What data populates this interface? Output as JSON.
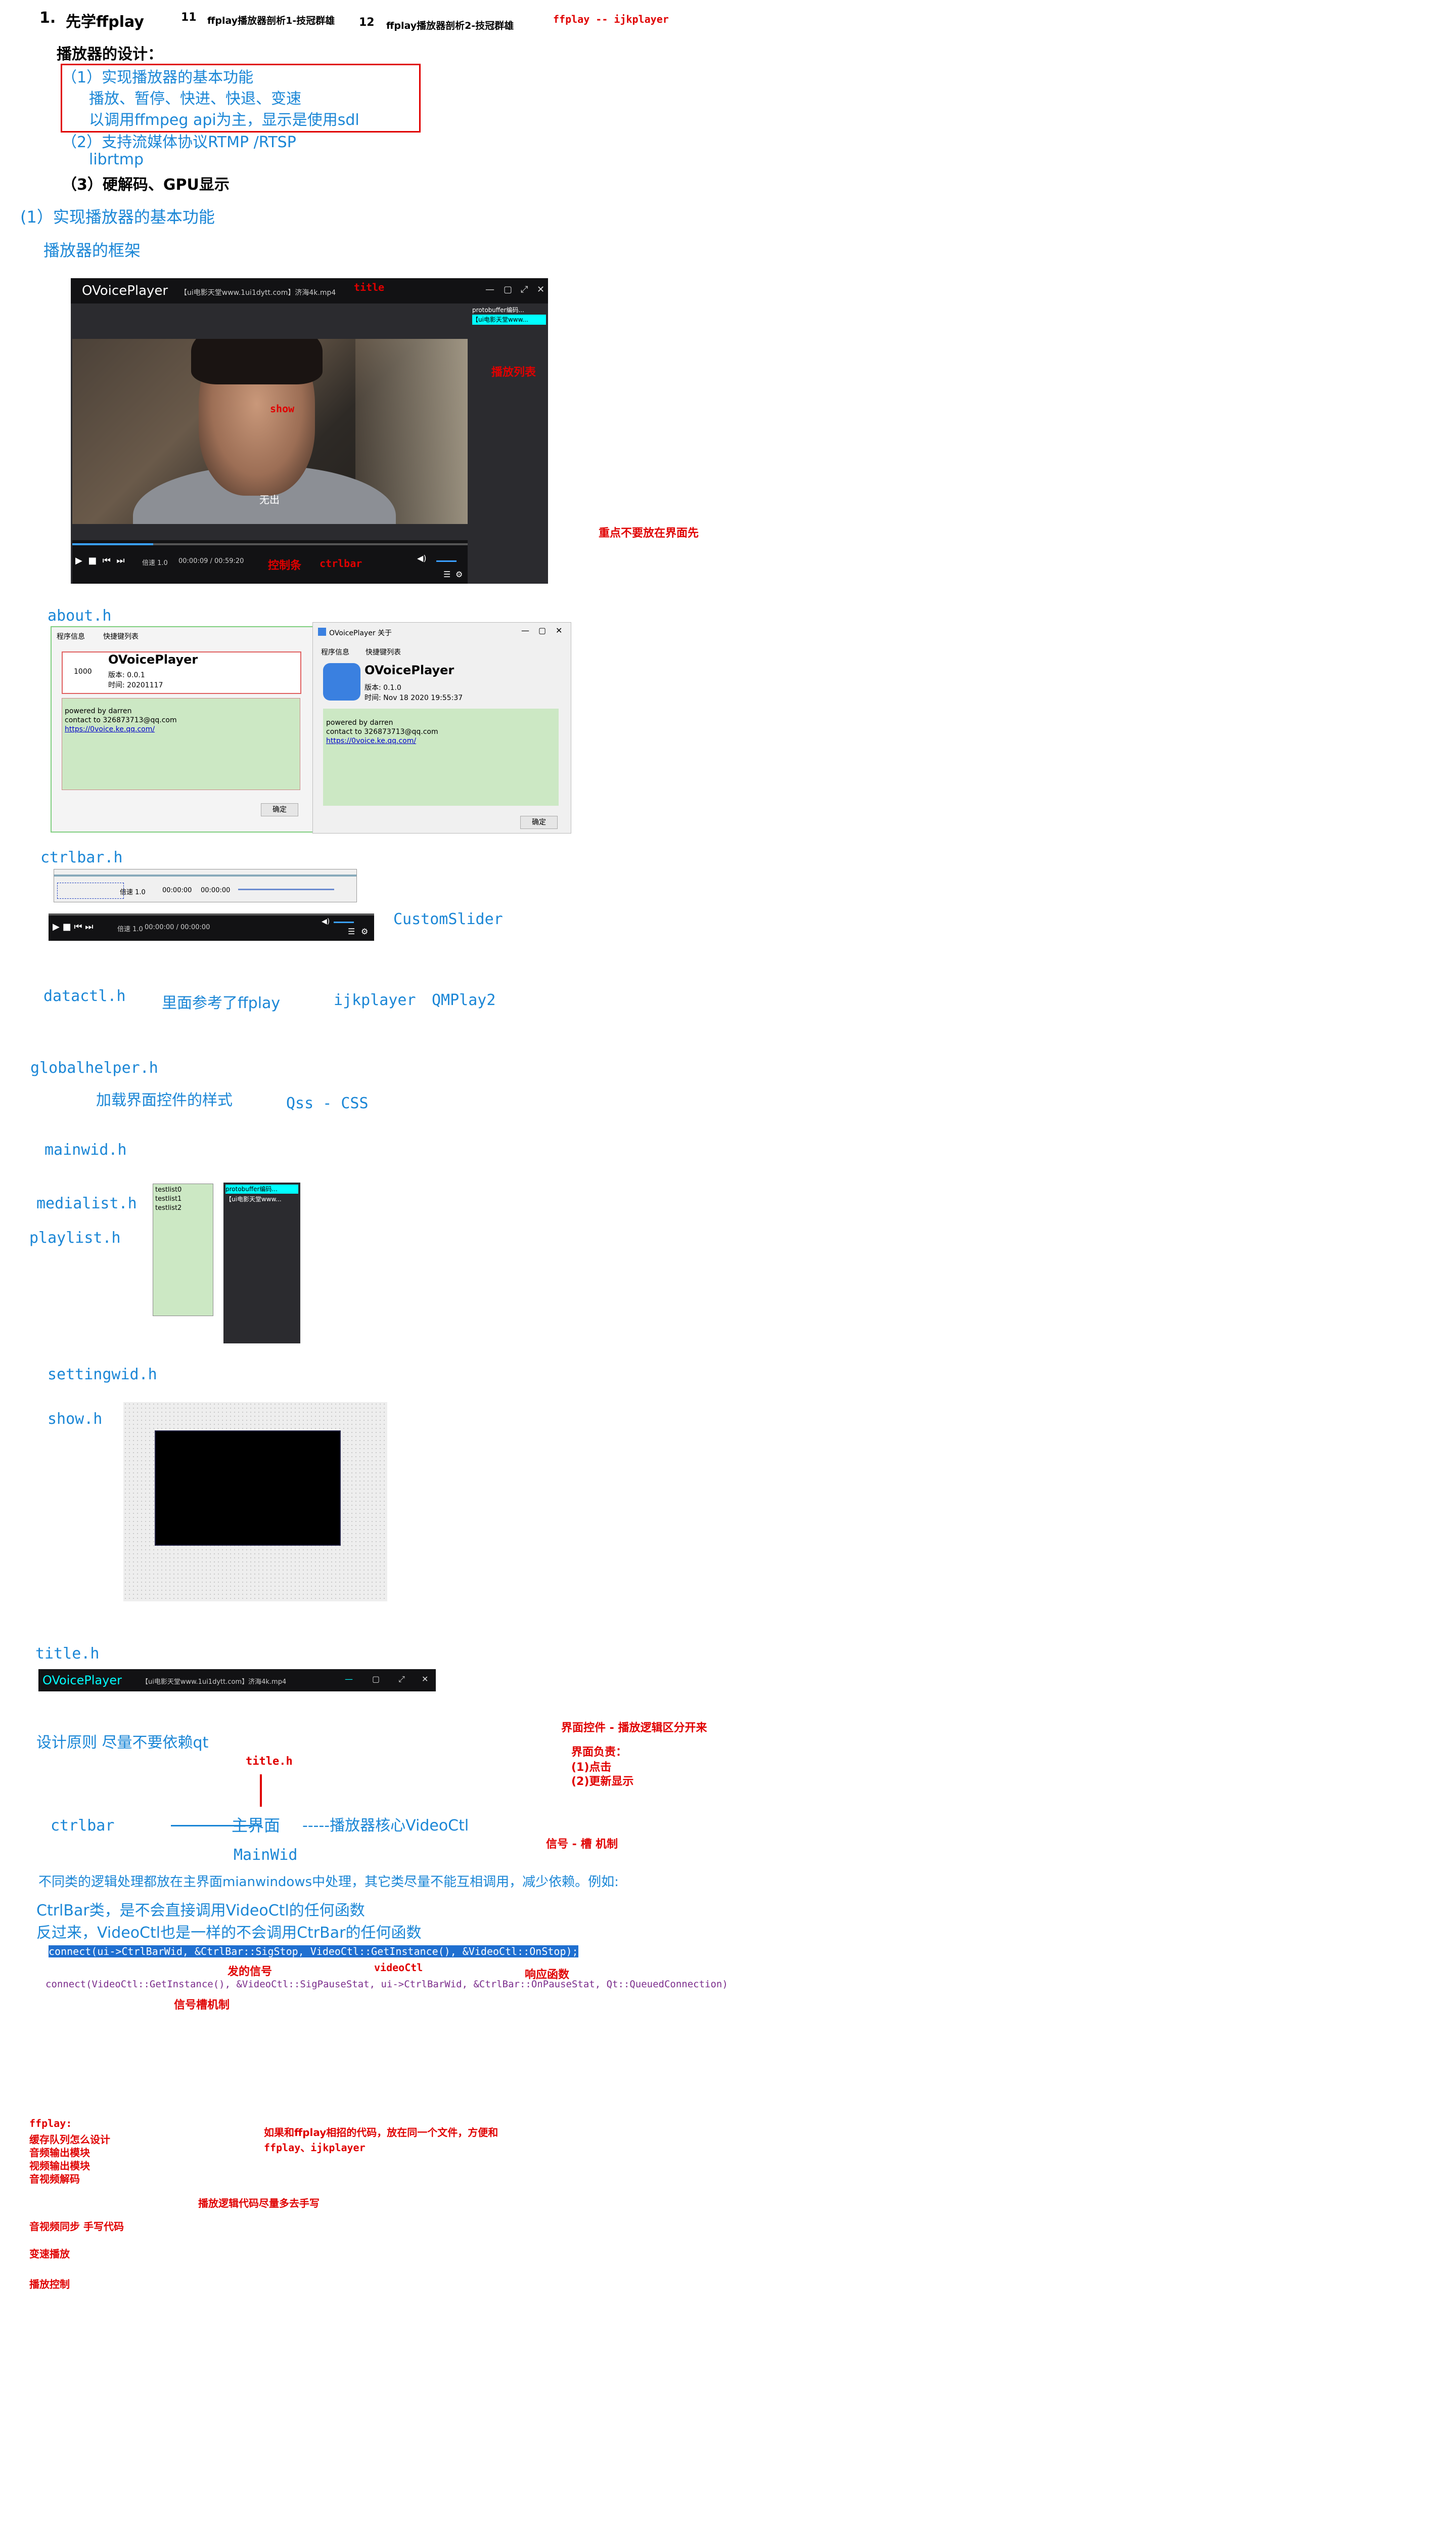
{
  "header": {
    "item1_prefix": "1.",
    "item1": "先学ffplay",
    "item2_num": "11",
    "item2": "ffplay播放器剖析1-技冠群雄",
    "item3_num": "12",
    "item3": "ffplay播放器剖析2-技冠群雄",
    "item4": "ffplay -- ijkplayer"
  },
  "design": {
    "title": "播放器的设计：",
    "p1": "（1）实现播放器的基本功能",
    "p1a": "播放、暂停、快进、快退、变速",
    "p1b": "以调用ffmpeg api为主，显示是使用sdl",
    "p2": "（2）支持流媒体协议RTMP /RTSP",
    "p2a": "librtmp",
    "p3": "（3）硬解码、GPU显示"
  },
  "section1": {
    "title": "(1）实现播放器的基本功能",
    "framework": "播放器的框架"
  },
  "player": {
    "logo": "OVoicePlayer",
    "filename": "【ui电影天堂www.1ui1dytt.com】济海4k.mp4",
    "title_label": "title",
    "show_label": "show",
    "playlist_label": "播放列表",
    "playlist_item1": "protobuffer编码...",
    "playlist_item2": "【ui电影天堂www...",
    "subtitle": "无出",
    "speed": "倍速 1.0",
    "time": "00:00:09 / 00:59:20",
    "ctrl_label": "控制条",
    "ctrl_label2": "ctrlbar",
    "note": "重点不要放在界面先",
    "btn_min": "—",
    "btn_max": "▢",
    "btn_full": "⤢",
    "btn_close": "✕"
  },
  "about": {
    "file": "about.h",
    "tab1": "程序信息",
    "tab2": "快捷键列表",
    "logo_num": "1000",
    "app": "OVoicePlayer",
    "version_design": "版本:  0.0.1",
    "time_design": "时间:  20201117",
    "powered": "powered by darren",
    "contact": "contact to 326873713@qq.com",
    "link": "https://0voice.ke.qq.com/",
    "ok": "确定",
    "win_title": "OVoicePlayer 关于",
    "version": "版本:  0.1.0",
    "time": "时间:  Nov 18 2020 19:55:37"
  },
  "ctrlbar": {
    "file": "ctrlbar.h",
    "speed": "倍速 1.0",
    "time_design": "00:00:00",
    "time_design2": "00:00:00",
    "time": "00:00:00 / 00:00:00",
    "custom_slider": "CustomSlider"
  },
  "datactl": {
    "file": "datactl.h",
    "desc": "里面参考了ffplay",
    "ref1": "ijkplayer",
    "ref2": "QMPlay2"
  },
  "globalhelper": {
    "file": "globalhelper.h",
    "desc": "加载界面控件的样式",
    "qss": "Qss - CSS"
  },
  "mainwid": {
    "file": "mainwid.h"
  },
  "medialist": {
    "file": "medialist.h",
    "items": [
      "testlist0",
      "testlist1",
      "testlist2"
    ]
  },
  "playlist": {
    "file": "playlist.h",
    "items": [
      "protobuffer编码...",
      "【ui电影天堂www..."
    ]
  },
  "settingwid": {
    "file": "settingwid.h"
  },
  "show": {
    "file": "show.h"
  },
  "title": {
    "file": "title.h",
    "logo": "OVoicePlayer",
    "filename": "【ui电影天堂www.1ui1dytt.com】济海4k.mp4"
  },
  "principles": {
    "title": "设计原则 尽量不要依赖qt",
    "ui_note": "界面控件  - 播放逻辑区分开来",
    "ui_resp": "界面负责：",
    "ui_resp1": "(1)点击",
    "ui_resp2": "(2)更新显示",
    "title_h": "title.h",
    "ctrlbar": "ctrlbar",
    "main": "主界面",
    "core": "-----播放器核心VideoCtl",
    "mainwid": "MainWid",
    "signal": "信号 - 槽 机制",
    "rule": "不同类的逻辑处理都放在主界面mianwindows中处理，其它类尽量不能互相调用，减少依赖。例如:",
    "rule1": "CtrlBar类，是不会直接调用VideoCtl的任何函数",
    "rule2": "反过来，VideoCtl也是一样的不会调用CtrBar的任何函数",
    "code1": "connect(ui->CtrlBarWid, &CtrlBar::SigStop, VideoCtl::GetInstance(), &VideoCtl::OnStop);",
    "code2": "connect(VideoCtl::GetInstance(), &VideoCtl::SigPauseStat, ui->CtrlBarWid, &CtrlBar::OnPauseStat, Qt::QueuedConnection)",
    "emit_signal": "发的信号",
    "videoctl": "videoCtl",
    "resp_func": "响应函数",
    "slot_mech": "信号槽机制"
  },
  "ffplay_notes": {
    "title": "ffplay:",
    "l1": "缓存队列怎么设计",
    "l2": "音频输出模块",
    "l3": "视频输出模块",
    "l4": "音视频解码",
    "same_file": "如果和ffplay相招的代码，放在同一个文件，方便和",
    "same_file2": "ffplay、ijkplayer",
    "hand": "播放逻辑代码尽量多去手写",
    "sync": "音视频同步  手写代码",
    "speed": "变速播放",
    "control": "播放控制"
  },
  "colors": {
    "blue": "#1a86d6",
    "red": "#e00000",
    "cyan": "#00ffff",
    "green_panel": "#cce8c4"
  }
}
